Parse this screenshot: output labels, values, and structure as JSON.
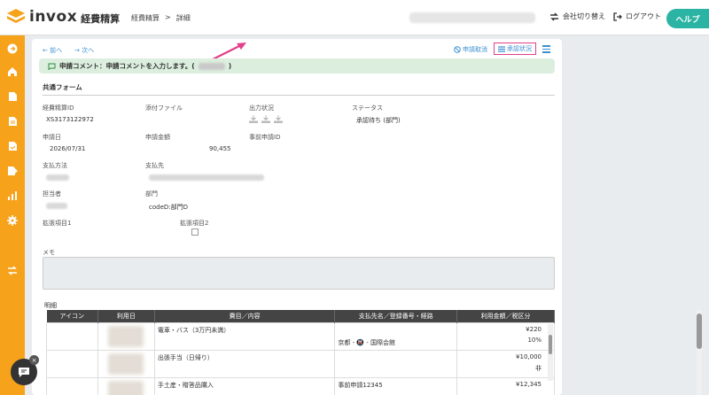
{
  "app": {
    "logo_text": "invox",
    "logo_sub": "経費精算",
    "breadcrumb": [
      "経費精算",
      "詳細"
    ],
    "breadcrumb_sep": ">",
    "switch_company": "会社切り替え",
    "logout": "ログアウト",
    "help": "ヘルプ"
  },
  "toolbar": {
    "prev": "← 前へ",
    "next": "→ 次へ",
    "cancel": "申請取消",
    "approval": "承認状況"
  },
  "comment": {
    "prefix": "申請コメント：申請コメントを入力します。(",
    "suffix": ")"
  },
  "form": {
    "title": "共通フォーム",
    "id_label": "経費精算ID",
    "id_value": "XS3173122972",
    "attachment_label": "添付ファイル",
    "output_label": "出力状況",
    "status_label": "ステータス",
    "status_value": "承認待ち (部門)",
    "date_label": "申請日",
    "date_value": "2026/07/31",
    "amount_label": "申請金額",
    "amount_value": "90,455",
    "pre_id_label": "事前申請ID",
    "pay_method_label": "支払方法",
    "payee_label": "支払先",
    "person_label": "担当者",
    "dept_label": "部門",
    "dept_value": "codeD:部門D",
    "ext1_label": "拡張項目1",
    "ext2_label": "拡張項目2",
    "memo_label": "メモ"
  },
  "detail": {
    "title": "明細",
    "headers": [
      "アイコン",
      "利用日",
      "費目／内容",
      "支払先名／登録番号・経路",
      "利用金額／税区分"
    ],
    "rows": [
      {
        "item": "電車・バス（3万円未満）",
        "route": "京都 - 🚇 - 国際会館",
        "amount": "¥220",
        "tax": "10%"
      },
      {
        "item": "出張手当（日帰り）",
        "route": "",
        "amount": "¥10,000",
        "tax": "非"
      },
      {
        "item": "手土産・贈答品購入",
        "route": "事前申請12345",
        "amount": "¥12,345",
        "tax": ""
      }
    ]
  },
  "colors": {
    "sidebar": "#f7a21b",
    "accent_blue": "#3a8fd1",
    "help": "#2bb3a3",
    "highlight": "#e33f8a",
    "comment_bg": "#dcefdf"
  }
}
